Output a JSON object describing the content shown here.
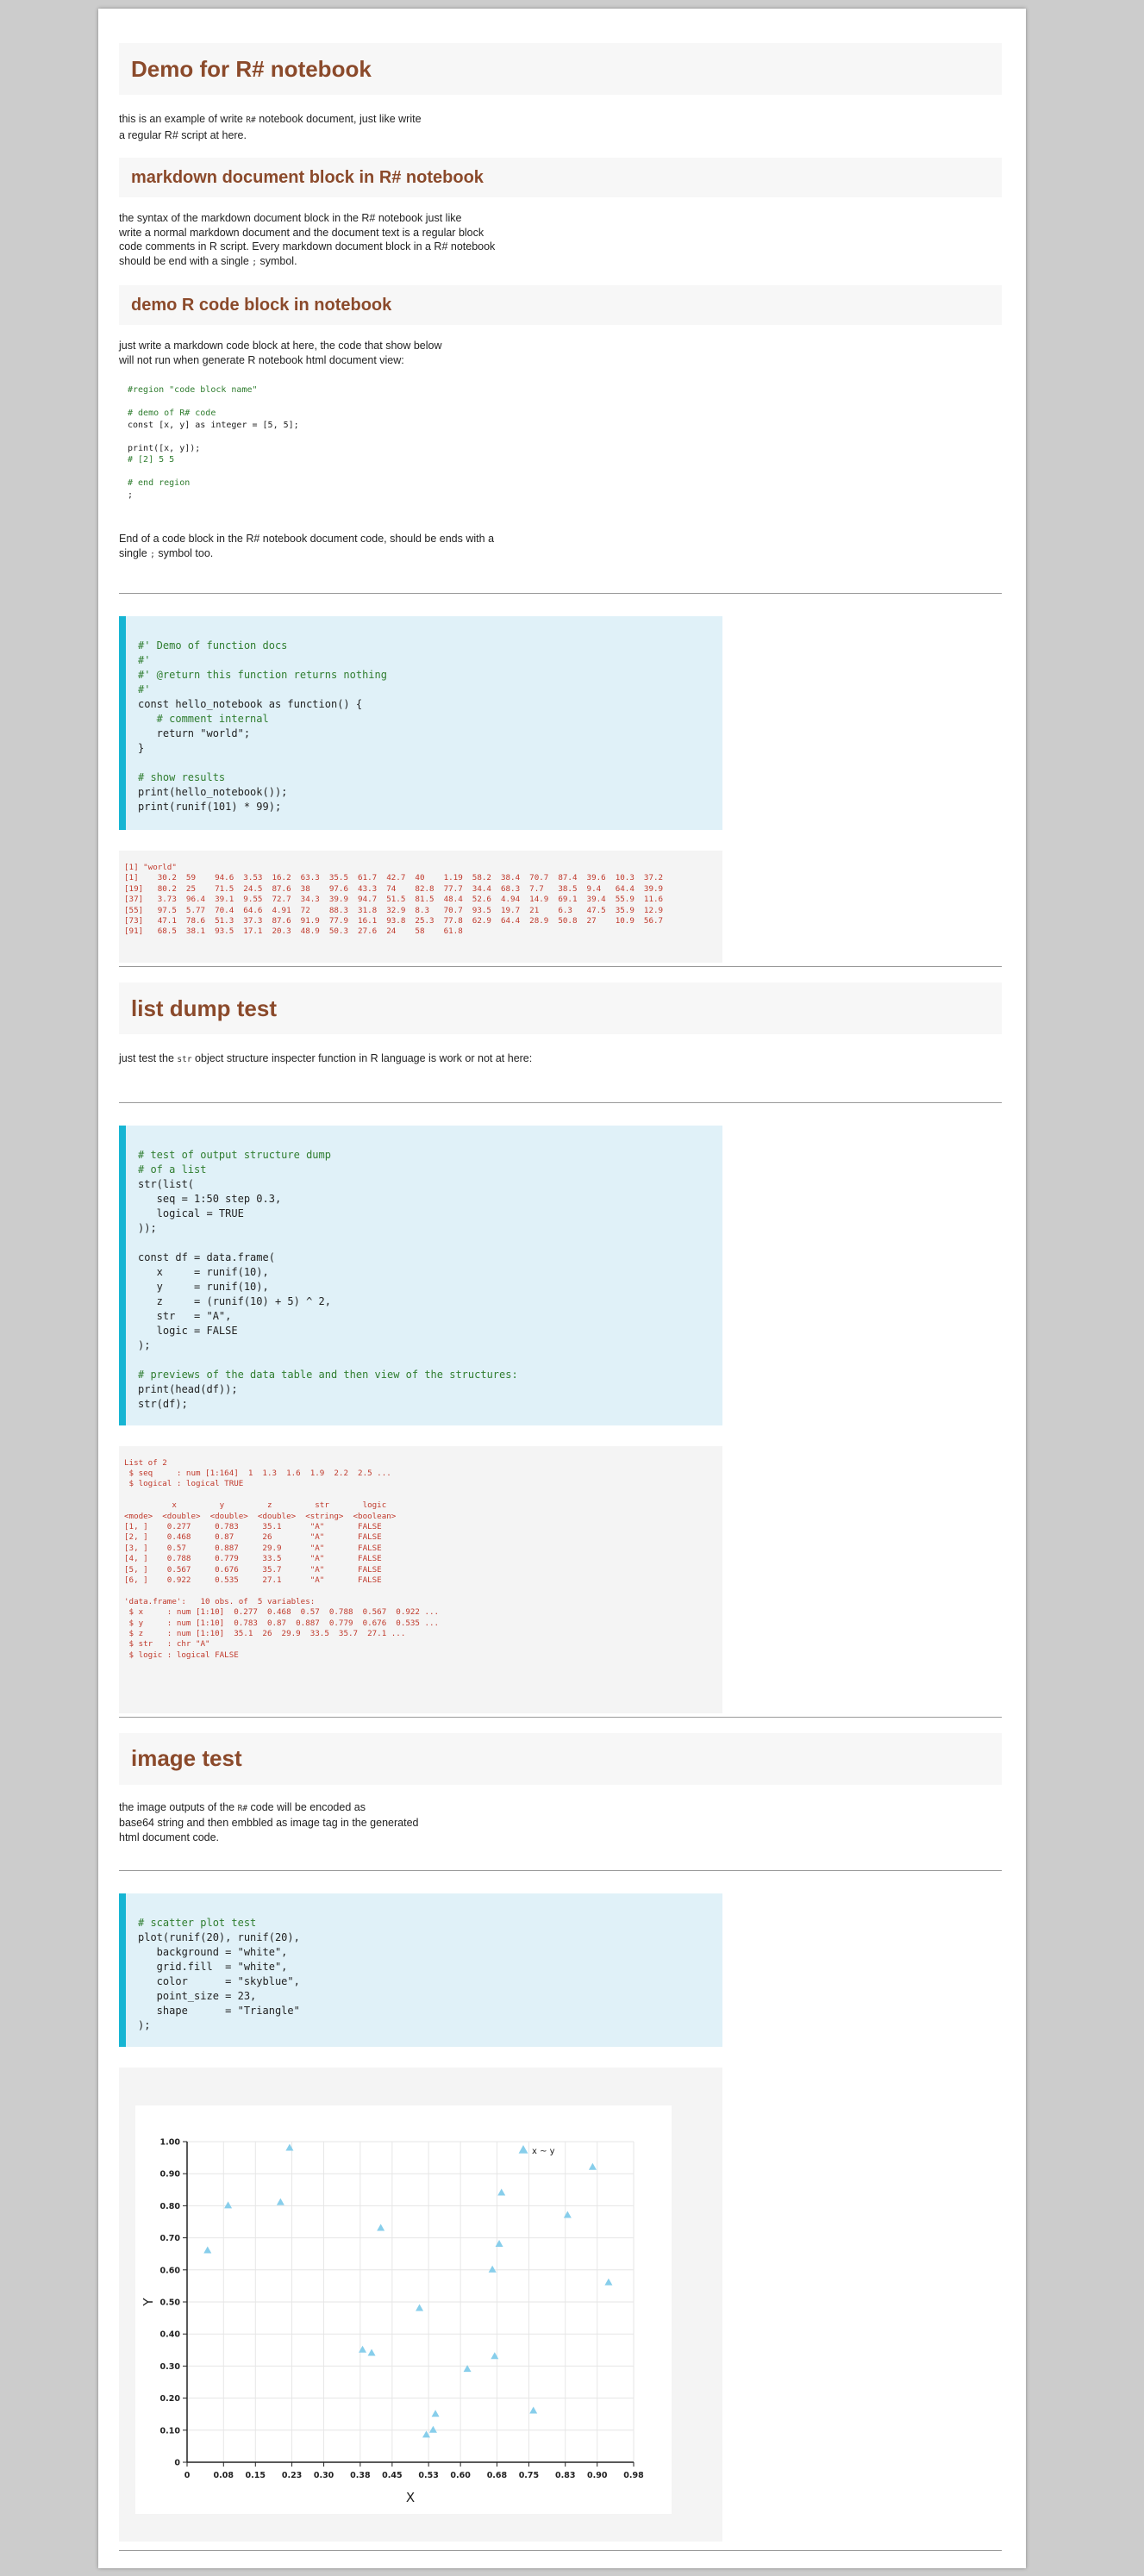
{
  "doc": {
    "title": "Demo for R# notebook",
    "intro": {
      "pre": "this is an example of write ",
      "code": "R#",
      "post": " notebook document, just like write\na regular R# script at here."
    },
    "section_markdown": {
      "heading": "markdown document block in R# notebook",
      "text_pre": "the syntax of the markdown document block in the R# notebook just like\nwrite a normal markdown document and the document text is a regular block\ncode comments in R script. Every markdown document block in a R# notebook\nshould be end with a single ",
      "text_code": ";",
      "text_post": " symbol."
    },
    "section_codeblock": {
      "heading": "demo R code block in notebook",
      "text": "just write a markdown code block at here, the code that show below\nwill not run when generate R notebook html document view:",
      "code_lines": [
        "#region \"code block name\"",
        "",
        "# demo of R# code",
        "const [x, y] as integer = [5, 5];",
        "",
        "print([x, y]);",
        "# [2] 5 5",
        "",
        "# end region",
        ";"
      ],
      "after_pre": "End of a code block in the R# notebook document code, should be ends with a\nsingle ",
      "after_code": ";",
      "after_post": " symbol too."
    },
    "cell1": {
      "code_lines": [
        "#' Demo of function docs",
        "#'",
        "#' @return this function returns nothing",
        "#'",
        "const hello_notebook as function() {",
        "   # comment internal",
        "   return \"world\";",
        "}",
        "",
        "# show results",
        "print(hello_notebook());",
        "print(runif(101) * 99);"
      ],
      "output_lines": [
        "[1] \"world\"",
        "[1]    30.2  59    94.6  3.53  16.2  63.3  35.5  61.7  42.7  40    1.19  58.2  38.4  70.7  87.4  39.6  10.3  37.2",
        "[19]   80.2  25    71.5  24.5  87.6  38    97.6  43.3  74    82.8  77.7  34.4  68.3  7.7   38.5  9.4   64.4  39.9",
        "[37]   3.73  96.4  39.1  9.55  72.7  34.3  39.9  94.7  51.5  81.5  48.4  52.6  4.94  14.9  69.1  39.4  55.9  11.6",
        "[55]   97.5  5.77  70.4  64.6  4.91  72    88.3  31.8  32.9  8.3   70.7  93.5  19.7  21    6.3   47.5  35.9  12.9",
        "[73]   47.1  78.6  51.3  37.3  87.6  91.9  77.9  16.1  93.8  25.3  77.8  62.9  64.4  28.9  50.8  27    10.9  56.7",
        "[91]   68.5  38.1  93.5  17.1  20.3  48.9  50.3  27.6  24    58    61.8"
      ]
    },
    "section_listdump": {
      "heading": "list dump test",
      "text_pre": "just test the ",
      "text_code": "str",
      "text_post": " object structure inspecter function in R language is work or not at here:"
    },
    "cell2": {
      "code_lines": [
        "# test of output structure dump",
        "# of a list",
        "str(list(",
        "   seq = 1:50 step 0.3,",
        "   logical = TRUE",
        "));",
        "",
        "const df = data.frame(",
        "   x     = runif(10),",
        "   y     = runif(10),",
        "   z     = (runif(10) + 5) ^ 2,",
        "   str   = \"A\",",
        "   logic = FALSE",
        ");",
        "",
        "# previews of the data table and then view of the structures:",
        "print(head(df));",
        "str(df);"
      ],
      "output_lines": [
        "List of 2",
        " $ seq     : num [1:164]  1  1.3  1.6  1.9  2.2  2.5 ...",
        " $ logical : logical TRUE",
        "",
        "          x         y         z         str       logic",
        "<mode>  <double>  <double>  <double>  <string>  <boolean>",
        "[1, ]    0.277     0.783     35.1      \"A\"       FALSE",
        "[2, ]    0.468     0.87      26        \"A\"       FALSE",
        "[3, ]    0.57      0.887     29.9      \"A\"       FALSE",
        "[4, ]    0.788     0.779     33.5      \"A\"       FALSE",
        "[5, ]    0.567     0.676     35.7      \"A\"       FALSE",
        "[6, ]    0.922     0.535     27.1      \"A\"       FALSE",
        "",
        "'data.frame':   10 obs. of  5 variables:",
        " $ x     : num [1:10]  0.277  0.468  0.57  0.788  0.567  0.922 ...",
        " $ y     : num [1:10]  0.783  0.87  0.887  0.779  0.676  0.535 ...",
        " $ z     : num [1:10]  35.1  26  29.9  33.5  35.7  27.1 ...",
        " $ str   : chr \"A\"",
        " $ logic : logical FALSE"
      ]
    },
    "section_image": {
      "heading": "image test",
      "text_pre": "the image outputs of the ",
      "text_code": "R#",
      "text_post": " code will be encoded as\nbase64 string and then embbled as image tag in the generated\nhtml document code."
    },
    "cell3": {
      "code_lines": [
        "# scatter plot test",
        "plot(runif(20), runif(20),",
        "   background = \"white\",",
        "   grid.fill  = \"white\",",
        "   color      = \"skyblue\",",
        "   point_size = 23,",
        "   shape      = \"Triangle\"",
        ");"
      ]
    }
  },
  "colors": {
    "heading": "#8b4a2b",
    "accent_bar": "#17b5d3",
    "code_bg": "#e0f1f8",
    "output_text": "#c0392b",
    "point": "#87ceeb"
  },
  "chart_data": {
    "type": "scatter",
    "xlabel": "X",
    "ylabel": "Y",
    "legend": {
      "label": "x ~ y",
      "placement": "top-right"
    },
    "xlim": [
      0,
      0.98
    ],
    "ylim": [
      0,
      1.0
    ],
    "x_ticks": [
      "0",
      "0.08",
      "0.15",
      "0.23",
      "0.30",
      "0.38",
      "0.45",
      "0.53",
      "0.60",
      "0.68",
      "0.75",
      "0.83",
      "0.90",
      "0.98"
    ],
    "y_ticks": [
      "0",
      "0.10",
      "0.20",
      "0.30",
      "0.40",
      "0.50",
      "0.60",
      "0.70",
      "0.80",
      "0.90",
      "1.00"
    ],
    "grid": true,
    "series": [
      {
        "x": [
          0.045,
          0.09,
          0.205,
          0.225,
          0.385,
          0.405,
          0.425,
          0.51,
          0.525,
          0.54,
          0.545,
          0.615,
          0.67,
          0.675,
          0.685,
          0.69,
          0.76,
          0.835,
          0.89,
          0.925
        ],
        "y": [
          0.66,
          0.8,
          0.81,
          0.98,
          0.35,
          0.34,
          0.73,
          0.48,
          0.085,
          0.1,
          0.15,
          0.29,
          0.6,
          0.33,
          0.68,
          0.84,
          0.16,
          0.77,
          0.92,
          0.56
        ]
      }
    ]
  }
}
